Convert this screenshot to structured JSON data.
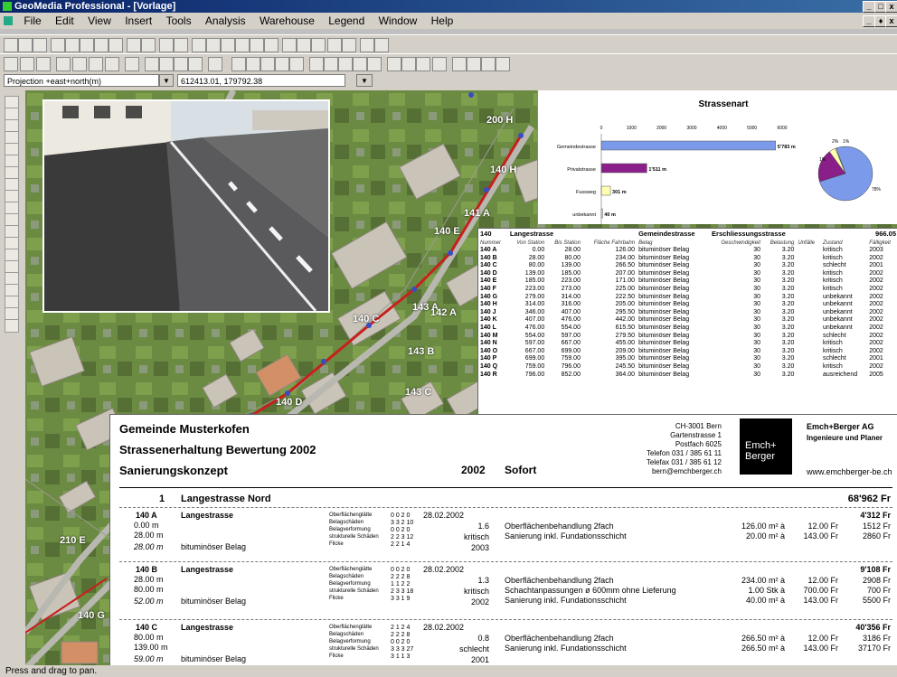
{
  "window": {
    "title": "GeoMedia Professional - [Vorlage]",
    "min": "_",
    "max": "□",
    "close": "x",
    "doc_min": "_",
    "doc_restore": "♦",
    "doc_close": "x"
  },
  "menu": [
    "File",
    "Edit",
    "View",
    "Insert",
    "Tools",
    "Analysis",
    "Warehouse",
    "Legend",
    "Window",
    "Help"
  ],
  "projection": {
    "label": "Projection +east+north(m)",
    "coords": "612413.01, 179792.38"
  },
  "status": "Press and drag to pan.",
  "map_labels": [
    "200 H",
    "140 H",
    "141 A",
    "140 E",
    "140 C",
    "143 A",
    "142 A",
    "143 B",
    "140 D",
    "143 C",
    "210 E",
    "140 G"
  ],
  "chart_data": {
    "type": "bar",
    "title": "Strassenart",
    "categories": [
      "Gemeindestrasse",
      "Privatstrasse",
      "Fussweg",
      "unbekannt"
    ],
    "values": [
      5783,
      1511,
      301,
      40
    ],
    "value_labels": [
      "5'783 m",
      "1'511 m",
      "301 m",
      "40 m"
    ],
    "xlim": [
      0,
      6000
    ],
    "x_ticks": [
      "0",
      "1000",
      "2000",
      "3000",
      "4000",
      "5000",
      "6000"
    ],
    "colors": [
      "#7b9bea",
      "#8a1f8a",
      "#ffffb0",
      "#ffffff"
    ],
    "pie_labels": [
      "2%",
      "1%",
      "1%",
      "78%"
    ]
  },
  "table": {
    "title": {
      "id": "140",
      "name": "Langestrasse",
      "type": "Gemeindestrasse",
      "class": "Erschliessungsstrasse",
      "total": "966.05"
    },
    "columns": [
      "Nummer",
      "Von Station",
      "Bis Station",
      "Fläche Fahrbahn",
      "Belag",
      "Geschwindigkeit",
      "Belastung",
      "Unfälle",
      "Zustand",
      "Fälligkeit"
    ],
    "rows": [
      [
        "140 A",
        "0.00",
        "28.00",
        "126.00",
        "bituminöser Belag",
        "30",
        "3.20",
        "kritisch",
        "2003"
      ],
      [
        "140 B",
        "28.00",
        "80.00",
        "234.00",
        "bituminöser Belag",
        "30",
        "3.20",
        "kritisch",
        "2002"
      ],
      [
        "140 C",
        "80.00",
        "139.00",
        "266.50",
        "bituminöser Belag",
        "30",
        "3.20",
        "schlecht",
        "2001"
      ],
      [
        "140 D",
        "139.00",
        "185.00",
        "207.00",
        "bituminöser Belag",
        "30",
        "3.20",
        "kritisch",
        "2002"
      ],
      [
        "140 E",
        "185.00",
        "223.00",
        "171.00",
        "bituminöser Belag",
        "30",
        "3.20",
        "kritisch",
        "2002"
      ],
      [
        "140 F",
        "223.00",
        "273.00",
        "225.00",
        "bituminöser Belag",
        "30",
        "3.20",
        "kritisch",
        "2002"
      ],
      [
        "140 G",
        "279.00",
        "314.00",
        "222.50",
        "bituminöser Belag",
        "30",
        "3.20",
        "unbekannt",
        "2002"
      ],
      [
        "140 H",
        "314.00",
        "316.00",
        "205.00",
        "bituminöser Belag",
        "30",
        "3.20",
        "unbekannt",
        "2002"
      ],
      [
        "140 J",
        "346.00",
        "407.00",
        "295.50",
        "bituminöser Belag",
        "30",
        "3.20",
        "unbekannt",
        "2002"
      ],
      [
        "140 K",
        "407.00",
        "476.00",
        "442.00",
        "bituminöser Belag",
        "30",
        "3.20",
        "unbekannt",
        "2002"
      ],
      [
        "140 L",
        "476.00",
        "554.00",
        "615.50",
        "bituminöser Belag",
        "30",
        "3.20",
        "unbekannt",
        "2002"
      ],
      [
        "140 M",
        "554.00",
        "597.00",
        "279.50",
        "bituminöser Belag",
        "30",
        "3.20",
        "schlecht",
        "2002"
      ],
      [
        "140 N",
        "597.00",
        "667.00",
        "455.00",
        "bituminöser Belag",
        "30",
        "3.20",
        "kritisch",
        "2002"
      ],
      [
        "140 O",
        "667.00",
        "699.00",
        "209.00",
        "bituminöser Belag",
        "30",
        "3.20",
        "kritisch",
        "2002"
      ],
      [
        "140 P",
        "699.00",
        "759.00",
        "395.00",
        "bituminöser Belag",
        "30",
        "3.20",
        "schlecht",
        "2001"
      ],
      [
        "140 Q",
        "759.00",
        "796.00",
        "245.50",
        "bituminöser Belag",
        "30",
        "3.20",
        "kritisch",
        "2002"
      ],
      [
        "140 R",
        "796.00",
        "852.00",
        "364.00",
        "bituminöser Belag",
        "30",
        "3.20",
        "ausreichend",
        "2005"
      ]
    ]
  },
  "report": {
    "line1": "Gemeinde Musterkofen",
    "line2": "Strassenerhaltung  Bewertung 2002",
    "line3": "Sanierungskonzept",
    "year": "2002",
    "sofort": "Sofort",
    "address": [
      "CH-3001 Bern",
      "Gartenstrasse 1",
      "Postfach 6025",
      "Telefon 031 / 385 61 11",
      "Telefax 031 / 385 61 12",
      "bern@emchberger.ch"
    ],
    "logo": "Emch+\nBerger",
    "company": "Emch+Berger AG",
    "company_sub": "Ingenieure und Planer",
    "website": "www.emchberger-be.ch",
    "section_no": "1",
    "section_name": "Langestrasse Nord",
    "section_total": "68'962  Fr",
    "criteria": [
      "Oberflächenglätte",
      "Belagschäden",
      "Belagverformung",
      "strukturelle Schäden",
      "Flicke"
    ],
    "segments": [
      {
        "id": "140 A",
        "name": "Langestrasse",
        "from": "0.00 m",
        "to": "28.00 m",
        "len": "28.00 m",
        "belag": "bituminöser Belag",
        "scores": [
          "0  0  2  0",
          "3  3  2  10",
          "0  0  2  0",
          "2  2  3  12",
          "2  2  1  4"
        ],
        "date": "28.02.2002",
        "index": "1.6",
        "state": "kritisch",
        "year": "2003",
        "measures": [
          "Oberflächenbehandlung 2fach",
          "Sanierung inkl. Fundationsschicht"
        ],
        "qty": [
          "126.00 m²  à",
          "20.00 m²  à"
        ],
        "price": [
          "12.00 Fr",
          "143.00 Fr"
        ],
        "cost": [
          "1512 Fr",
          "2860 Fr"
        ],
        "total": "4'312 Fr"
      },
      {
        "id": "140 B",
        "name": "Langestrasse",
        "from": "28.00 m",
        "to": "80.00 m",
        "len": "52.00 m",
        "belag": "bituminöser Belag",
        "scores": [
          "0  0  2  0",
          "2  2  2  8",
          "1  1  2  2",
          "2  3  3  18",
          "3  3  1  9"
        ],
        "date": "28.02.2002",
        "index": "1.3",
        "state": "kritisch",
        "year": "2002",
        "measures": [
          "Oberflächenbehandlung 2fach",
          "Schachtanpassungen ø 600mm ohne Lieferung",
          "Sanierung inkl. Fundationsschicht"
        ],
        "qty": [
          "234.00 m²  à",
          "1.00 Stk  à",
          "40.00 m²  à"
        ],
        "price": [
          "12.00 Fr",
          "700.00 Fr",
          "143.00 Fr"
        ],
        "cost": [
          "2908 Fr",
          "700 Fr",
          "5500 Fr"
        ],
        "total": "9'108 Fr"
      },
      {
        "id": "140 C",
        "name": "Langestrasse",
        "from": "80.00 m",
        "to": "139.00 m",
        "len": "59.00 m",
        "belag": "bituminöser Belag",
        "scores": [
          "2  1  2  4",
          "2  2  2  8",
          "0  0  2  0",
          "3  3  3  27",
          "3  1  1  3"
        ],
        "date": "28.02.2002",
        "index": "0.8",
        "state": "schlecht",
        "year": "2001",
        "measures": [
          "Oberflächenbehandlung 2fach",
          "Sanierung inkl. Fundationsschicht"
        ],
        "qty": [
          "266.50 m²  à",
          "266.50 m²  à"
        ],
        "price": [
          "12.00 Fr",
          "143.00 Fr"
        ],
        "cost": [
          "3186 Fr",
          "37170 Fr"
        ],
        "total": "40'356 Fr"
      }
    ]
  }
}
